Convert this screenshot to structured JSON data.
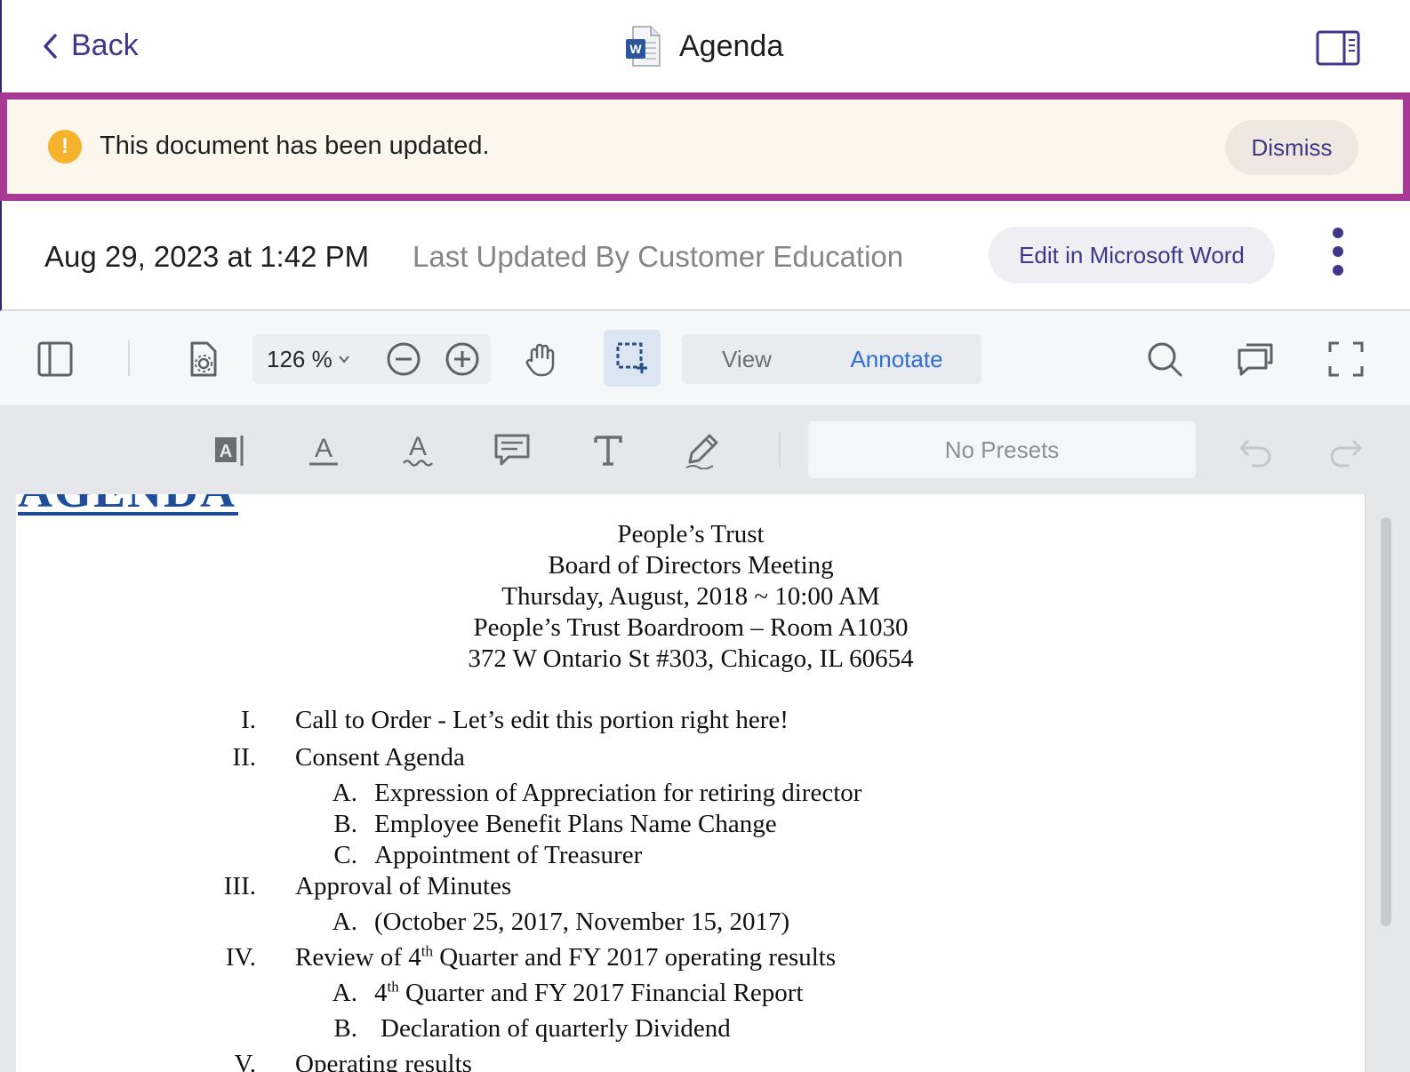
{
  "nav": {
    "back_label": "Back",
    "title": "Agenda"
  },
  "banner": {
    "icon": "!",
    "message": "This document has been updated.",
    "dismiss_label": "Dismiss"
  },
  "meta": {
    "date": "Aug 29, 2023 at 1:42 PM",
    "updated_by": "Last Updated By Customer Education",
    "edit_label": "Edit in Microsoft Word"
  },
  "toolbar": {
    "zoom_value": "126 %",
    "mode_view": "View",
    "mode_annotate": "Annotate",
    "presets": "No Presets"
  },
  "document": {
    "heading": "AGENDA",
    "header_lines": [
      "People’s Trust",
      "Board of Directors Meeting",
      "Thursday, August, 2018 ~ 10:00 AM",
      "People’s Trust Boardroom – Room A1030",
      "372 W Ontario St #303, Chicago, IL 60654"
    ],
    "items": [
      {
        "num": "I.",
        "text": "Call to Order - Let’s edit this portion right here!"
      },
      {
        "num": "II.",
        "text": "Consent Agenda"
      },
      {
        "num": "A.",
        "text": "Expression of Appreciation for retiring director"
      },
      {
        "num": "B.",
        "text": "Employee Benefit Plans Name Change"
      },
      {
        "num": "C.",
        "text": "Appointment of Treasurer"
      },
      {
        "num": "III.",
        "text": "Approval of Minutes"
      },
      {
        "num": "A.",
        "text": "(October 25, 2017, November 15, 2017)"
      },
      {
        "num": "IV.",
        "text_a": "Review of 4",
        "sup": "th",
        "text_b": " Quarter and FY 2017 operating results"
      },
      {
        "num": "A.",
        "text_a": "4",
        "sup": "th",
        "text_b": " Quarter and FY 2017 Financial Report"
      },
      {
        "num": "B.",
        "text": "Declaration of quarterly Dividend"
      },
      {
        "num": "V.",
        "text": "Operating results"
      }
    ]
  },
  "colors": {
    "brand": "#3f3789",
    "banner_border": "#a83a96",
    "banner_bg": "#fdf6ec",
    "warning": "#f4b32a",
    "annotate_active": "#2f6fd1",
    "agenda_heading": "#1e4e9a"
  }
}
